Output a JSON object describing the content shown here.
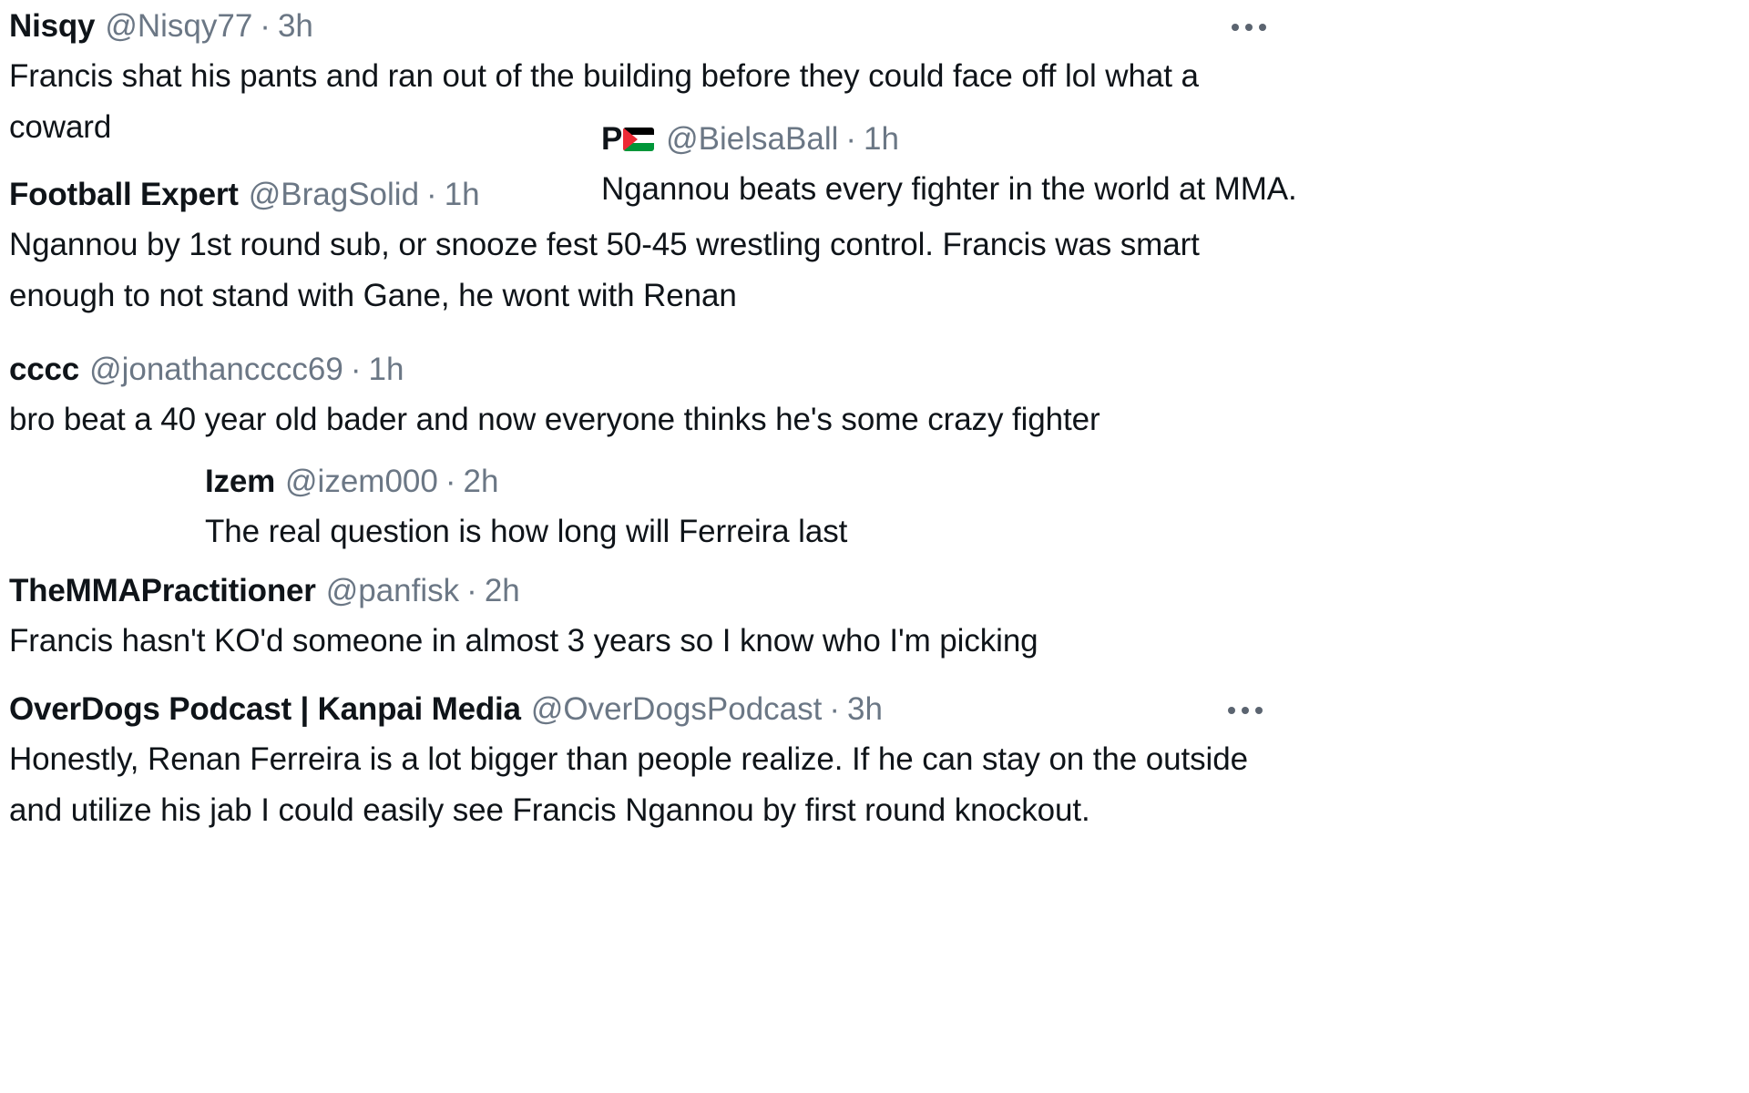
{
  "page": {
    "background_color": "#ffffff",
    "text_color": "#0f1419",
    "muted_color": "#6b7785"
  },
  "tweets": [
    {
      "id": "nisqy",
      "display_name": "Nisqy",
      "handle": "@Nisqy77",
      "separator": "·",
      "timestamp": "3h",
      "text": "Francis shat his pants and ran out of the building before they could face off lol what a coward",
      "has_more_menu": true,
      "emoji": null
    },
    {
      "id": "bielsaball",
      "display_name": "P",
      "handle": "@BielsaBall",
      "separator": "·",
      "timestamp": "1h",
      "text": "Ngannou beats every fighter in the world at MMA.",
      "has_more_menu": false,
      "emoji": "palestine-flag"
    },
    {
      "id": "football-expert",
      "display_name": "Football Expert",
      "handle": "@BragSolid",
      "separator": "·",
      "timestamp": "1h",
      "text": "Ngannou by 1st round sub, or snooze fest 50-45 wrestling control. Francis was smart enough to not stand with Gane, he wont with Renan",
      "has_more_menu": false,
      "emoji": null
    },
    {
      "id": "cccc",
      "display_name": "cccc",
      "handle": "@jonathancccc69",
      "separator": "·",
      "timestamp": "1h",
      "text": "bro beat a 40 year old bader and now everyone thinks he's some crazy fighter",
      "has_more_menu": false,
      "emoji": null
    },
    {
      "id": "izem",
      "display_name": "Izem",
      "handle": "@izem000",
      "separator": "·",
      "timestamp": "2h",
      "text": "The real question is how long will Ferreira last",
      "has_more_menu": false,
      "emoji": null
    },
    {
      "id": "themmapractitioner",
      "display_name": "TheMMAPractitioner",
      "handle": "@panfisk",
      "separator": "·",
      "timestamp": "2h",
      "text": "Francis hasn't KO'd someone in almost 3 years so I know who I'm picking",
      "has_more_menu": false,
      "emoji": null
    },
    {
      "id": "overdogs",
      "display_name": "OverDogs Podcast | Kanpai Media",
      "handle": "@OverDogsPodcast",
      "separator": "·",
      "timestamp": "3h",
      "text": "Honestly, Renan Ferreira is a lot bigger than people realize. If he can stay on the outside and utilize his jab I could easily see Francis Ngannou by first round knockout.",
      "has_more_menu": true,
      "emoji": null
    }
  ],
  "icons": {
    "more_options": "more-options-icon",
    "palestine_flag": "palestine-flag-icon"
  }
}
